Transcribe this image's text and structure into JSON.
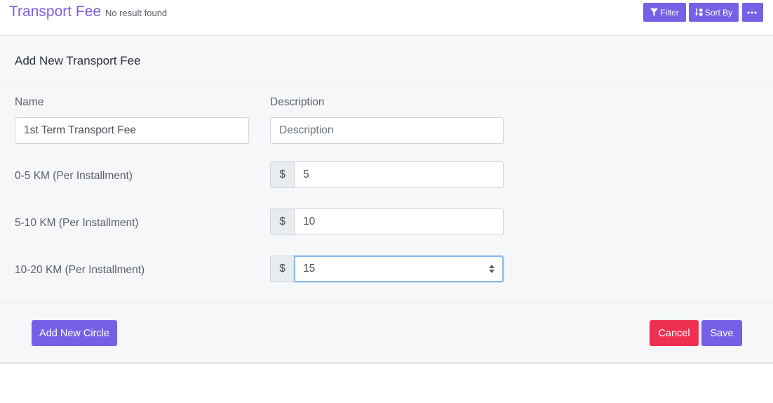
{
  "header": {
    "title": "Transport Fee",
    "subtitle": "No result found",
    "filter_label": "Filter",
    "sort_label": "Sort By"
  },
  "form": {
    "title": "Add New Transport Fee",
    "name_label": "Name",
    "name_value": "1st Term Transport Fee",
    "description_label": "Description",
    "description_placeholder": "Description",
    "currency_symbol": "$",
    "ranges": [
      {
        "label": "0-5 KM (Per Installment)",
        "value": "5"
      },
      {
        "label": "5-10 KM (Per Installment)",
        "value": "10"
      },
      {
        "label": "10-20 KM (Per Installment)",
        "value": "15"
      }
    ]
  },
  "footer": {
    "add_circle_label": "Add New Circle",
    "cancel_label": "Cancel",
    "save_label": "Save"
  },
  "colors": {
    "accent": "#7560e6",
    "danger": "#ef2f52",
    "title": "#7b61e0"
  }
}
